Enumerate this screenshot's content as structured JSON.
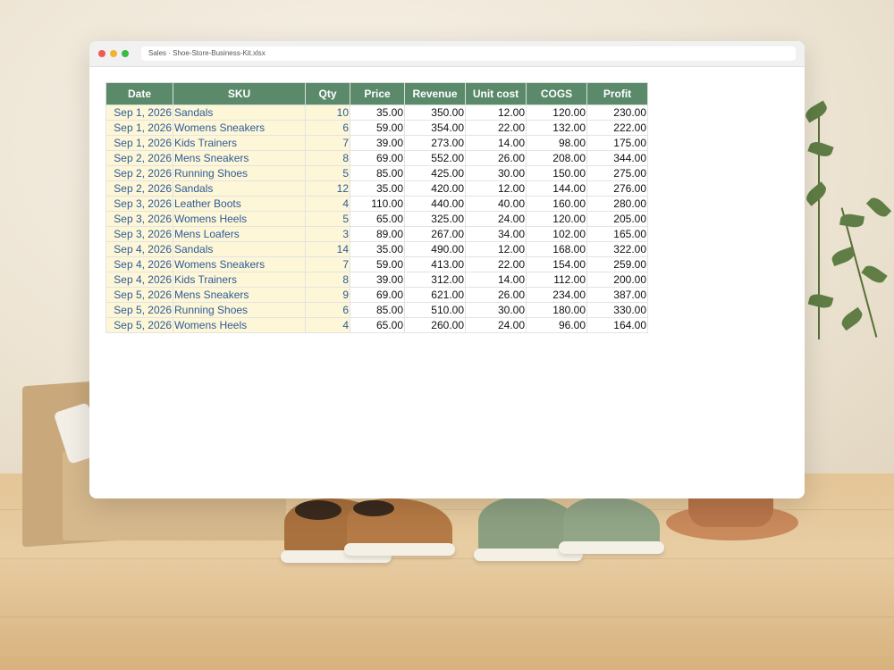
{
  "window": {
    "address": "Sales · Shoe-Store-Business-Kit.xlsx"
  },
  "sheet": {
    "headers": [
      "Date",
      "SKU",
      "Qty",
      "Price",
      "Revenue",
      "Unit cost",
      "COGS",
      "Profit"
    ],
    "header_color": "#5b8a6b",
    "input_cell_color": "#fdf7d7",
    "input_text_color": "#2e5a9a",
    "rows": [
      {
        "date": "Sep 1, 2026",
        "sku": "Sandals",
        "qty": "10",
        "price": "35.00",
        "revenue": "350.00",
        "unit_cost": "12.00",
        "cogs": "120.00",
        "profit": "230.00"
      },
      {
        "date": "Sep 1, 2026",
        "sku": "Womens Sneakers",
        "qty": "6",
        "price": "59.00",
        "revenue": "354.00",
        "unit_cost": "22.00",
        "cogs": "132.00",
        "profit": "222.00"
      },
      {
        "date": "Sep 1, 2026",
        "sku": "Kids Trainers",
        "qty": "7",
        "price": "39.00",
        "revenue": "273.00",
        "unit_cost": "14.00",
        "cogs": "98.00",
        "profit": "175.00"
      },
      {
        "date": "Sep 2, 2026",
        "sku": "Mens Sneakers",
        "qty": "8",
        "price": "69.00",
        "revenue": "552.00",
        "unit_cost": "26.00",
        "cogs": "208.00",
        "profit": "344.00"
      },
      {
        "date": "Sep 2, 2026",
        "sku": "Running Shoes",
        "qty": "5",
        "price": "85.00",
        "revenue": "425.00",
        "unit_cost": "30.00",
        "cogs": "150.00",
        "profit": "275.00"
      },
      {
        "date": "Sep 2, 2026",
        "sku": "Sandals",
        "qty": "12",
        "price": "35.00",
        "revenue": "420.00",
        "unit_cost": "12.00",
        "cogs": "144.00",
        "profit": "276.00"
      },
      {
        "date": "Sep 3, 2026",
        "sku": "Leather Boots",
        "qty": "4",
        "price": "110.00",
        "revenue": "440.00",
        "unit_cost": "40.00",
        "cogs": "160.00",
        "profit": "280.00"
      },
      {
        "date": "Sep 3, 2026",
        "sku": "Womens Heels",
        "qty": "5",
        "price": "65.00",
        "revenue": "325.00",
        "unit_cost": "24.00",
        "cogs": "120.00",
        "profit": "205.00"
      },
      {
        "date": "Sep 3, 2026",
        "sku": "Mens Loafers",
        "qty": "3",
        "price": "89.00",
        "revenue": "267.00",
        "unit_cost": "34.00",
        "cogs": "102.00",
        "profit": "165.00"
      },
      {
        "date": "Sep 4, 2026",
        "sku": "Sandals",
        "qty": "14",
        "price": "35.00",
        "revenue": "490.00",
        "unit_cost": "12.00",
        "cogs": "168.00",
        "profit": "322.00"
      },
      {
        "date": "Sep 4, 2026",
        "sku": "Womens Sneakers",
        "qty": "7",
        "price": "59.00",
        "revenue": "413.00",
        "unit_cost": "22.00",
        "cogs": "154.00",
        "profit": "259.00"
      },
      {
        "date": "Sep 4, 2026",
        "sku": "Kids Trainers",
        "qty": "8",
        "price": "39.00",
        "revenue": "312.00",
        "unit_cost": "14.00",
        "cogs": "112.00",
        "profit": "200.00"
      },
      {
        "date": "Sep 5, 2026",
        "sku": "Mens Sneakers",
        "qty": "9",
        "price": "69.00",
        "revenue": "621.00",
        "unit_cost": "26.00",
        "cogs": "234.00",
        "profit": "387.00"
      },
      {
        "date": "Sep 5, 2026",
        "sku": "Running Shoes",
        "qty": "6",
        "price": "85.00",
        "revenue": "510.00",
        "unit_cost": "30.00",
        "cogs": "180.00",
        "profit": "330.00"
      },
      {
        "date": "Sep 5, 2026",
        "sku": "Womens Heels",
        "qty": "4",
        "price": "65.00",
        "revenue": "260.00",
        "unit_cost": "24.00",
        "cogs": "96.00",
        "profit": "164.00"
      }
    ]
  }
}
